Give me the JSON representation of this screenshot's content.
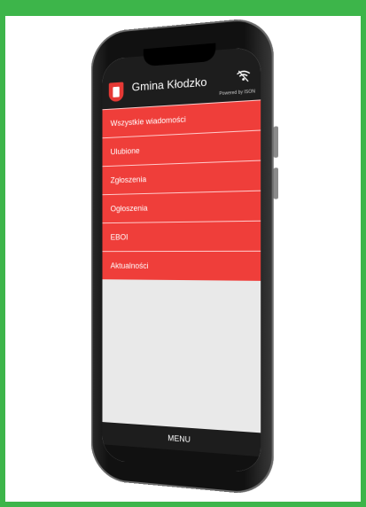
{
  "app": {
    "title": "Gmina Kłodzko",
    "powered": "Powered by ISON"
  },
  "menu": {
    "items": [
      {
        "label": "Wszystkie wiadomości"
      },
      {
        "label": "Ulubione"
      },
      {
        "label": "Zgłoszenia"
      },
      {
        "label": "Ogłoszenia"
      },
      {
        "label": "EBOI"
      },
      {
        "label": "Aktualności"
      }
    ]
  },
  "footer": {
    "menu_label": "MENU"
  },
  "colors": {
    "background": "#3db54a",
    "accent": "#ef3e3a",
    "header": "#1d1d1d"
  },
  "icons": [
    "coat-of-arms-logo",
    "wifi-off-icon"
  ]
}
